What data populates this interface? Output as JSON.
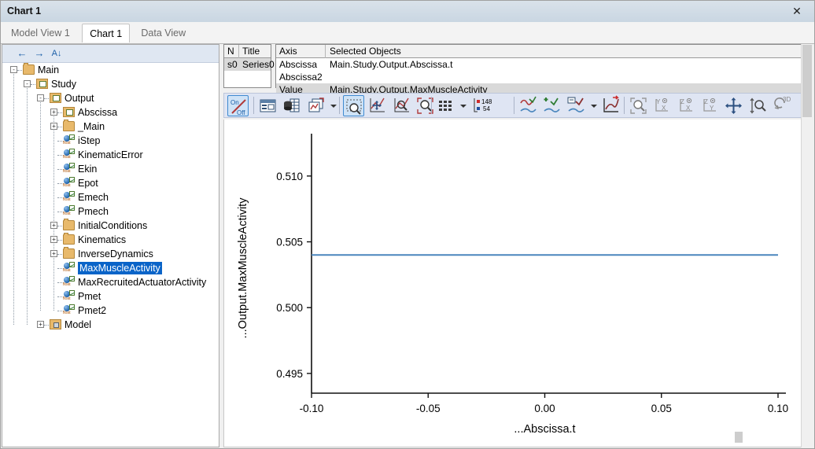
{
  "window": {
    "title": "Chart 1",
    "close_label": "✕"
  },
  "tabs": [
    {
      "label": "Model View 1",
      "active": false
    },
    {
      "label": "Chart 1",
      "active": true
    },
    {
      "label": "Data View",
      "active": false
    }
  ],
  "tree_toolbar": {
    "back": "←",
    "forward": "→",
    "sort": "A↓"
  },
  "tree": {
    "nodes": [
      {
        "label": "Main",
        "depth": 0,
        "icon": "folder",
        "expander": "-",
        "selected": false
      },
      {
        "label": "Study",
        "depth": 1,
        "icon": "folderchart",
        "expander": "-",
        "selected": false
      },
      {
        "label": "Output",
        "depth": 2,
        "icon": "folderchart",
        "expander": "-",
        "selected": false
      },
      {
        "label": "Abscissa",
        "depth": 3,
        "icon": "folderchart",
        "expander": "+",
        "selected": false
      },
      {
        "label": "_Main",
        "depth": 3,
        "icon": "folder",
        "expander": "+",
        "selected": false
      },
      {
        "label": "iStep",
        "depth": 3,
        "icon": "float",
        "expander": "",
        "selected": false
      },
      {
        "label": "KinematicError",
        "depth": 3,
        "icon": "float",
        "expander": "",
        "selected": false
      },
      {
        "label": "Ekin",
        "depth": 3,
        "icon": "float",
        "expander": "",
        "selected": false
      },
      {
        "label": "Epot",
        "depth": 3,
        "icon": "float",
        "expander": "",
        "selected": false
      },
      {
        "label": "Emech",
        "depth": 3,
        "icon": "float",
        "expander": "",
        "selected": false
      },
      {
        "label": "Pmech",
        "depth": 3,
        "icon": "float",
        "expander": "",
        "selected": false
      },
      {
        "label": "InitialConditions",
        "depth": 3,
        "icon": "folder",
        "expander": "+",
        "selected": false
      },
      {
        "label": "Kinematics",
        "depth": 3,
        "icon": "folder",
        "expander": "+",
        "selected": false
      },
      {
        "label": "InverseDynamics",
        "depth": 3,
        "icon": "folder",
        "expander": "+",
        "selected": false
      },
      {
        "label": "MaxMuscleActivity",
        "depth": 3,
        "icon": "float",
        "expander": "",
        "selected": true
      },
      {
        "label": "MaxRecruitedActuatorActivity",
        "depth": 3,
        "icon": "float",
        "expander": "",
        "selected": false
      },
      {
        "label": "Pmet",
        "depth": 3,
        "icon": "float",
        "expander": "",
        "selected": false
      },
      {
        "label": "Pmet2",
        "depth": 3,
        "icon": "float",
        "expander": "",
        "selected": false
      },
      {
        "label": "Model",
        "depth": 2,
        "icon": "modelf",
        "expander": "+",
        "selected": false
      }
    ]
  },
  "series_table": {
    "headers": [
      "N",
      "Title"
    ],
    "rows": [
      {
        "n": "s0",
        "title": "Series0"
      }
    ]
  },
  "axis_table": {
    "headers": [
      "Axis",
      "Selected Objects"
    ],
    "rows": [
      {
        "axis": "Abscissa",
        "object": "Main.Study.Output.Abscissa.t",
        "shaded": false
      },
      {
        "axis": "Abscissa2",
        "object": "",
        "shaded": false
      },
      {
        "axis": "Value",
        "object": "Main.Study.Output.MaxMuscleActivity",
        "shaded": true
      }
    ]
  },
  "toolbar": {
    "buttons": [
      {
        "name": "on-off-toggle-icon",
        "text": "On/Off",
        "active": true
      },
      {
        "name": "chart-properties-icon",
        "text": "",
        "active": false
      },
      {
        "name": "data-table-icon",
        "text": "",
        "active": false
      },
      {
        "name": "new-chart-icon",
        "text": "",
        "active": false
      },
      {
        "name": "zoom-rectangle-icon",
        "text": "",
        "active": true
      },
      {
        "name": "pan-chart-icon",
        "text": "",
        "active": false
      },
      {
        "name": "zoom-axis-icon",
        "text": "",
        "active": false
      },
      {
        "name": "zoom-fit-icon",
        "text": "",
        "active": false
      },
      {
        "name": "grid-icon",
        "text": "",
        "active": false
      },
      {
        "name": "point-count-icon",
        "text": "148 54",
        "active": false
      },
      {
        "name": "curve-style-icon",
        "text": "",
        "active": false
      },
      {
        "name": "add-curve-icon",
        "text": "",
        "active": false
      },
      {
        "name": "curve-label-icon",
        "text": "",
        "active": false
      },
      {
        "name": "export-curve-icon",
        "text": "",
        "active": false
      },
      {
        "name": "zoom-reset-icon",
        "text": "",
        "active": false
      },
      {
        "name": "view-yx-icon",
        "text": "YX",
        "active": false
      },
      {
        "name": "view-zx-icon",
        "text": "ZX",
        "active": false
      },
      {
        "name": "view-zy-icon",
        "text": "ZY",
        "active": false
      },
      {
        "name": "move-view-icon",
        "text": "",
        "active": false
      },
      {
        "name": "zoom-vertical-icon",
        "text": "",
        "active": false
      },
      {
        "name": "rotate-3d-icon",
        "text": "3D",
        "active": false
      }
    ],
    "point_count_top": "148",
    "point_count_bottom": "54"
  },
  "chart_data": {
    "type": "line",
    "title": "",
    "xlabel": "...Abscissa.t",
    "ylabel": "...Output.MaxMuscleActivity",
    "xlim": [
      -0.1,
      0.1
    ],
    "ylim": [
      0.4935,
      0.5125
    ],
    "xticks": [
      -0.1,
      -0.05,
      0.0,
      0.05,
      0.1
    ],
    "xticklabels": [
      "-0.10",
      "-0.05",
      "0.00",
      "0.05",
      "0.10"
    ],
    "yticks": [
      0.495,
      0.5,
      0.505,
      0.51
    ],
    "yticklabels": [
      "0.495",
      "0.500",
      "0.505",
      "0.510"
    ],
    "grid": false,
    "legend": false,
    "series": [
      {
        "name": "Series0",
        "color": "#4a86bd",
        "x": [
          -0.1,
          0.1
        ],
        "values": [
          0.504,
          0.504
        ]
      }
    ]
  }
}
